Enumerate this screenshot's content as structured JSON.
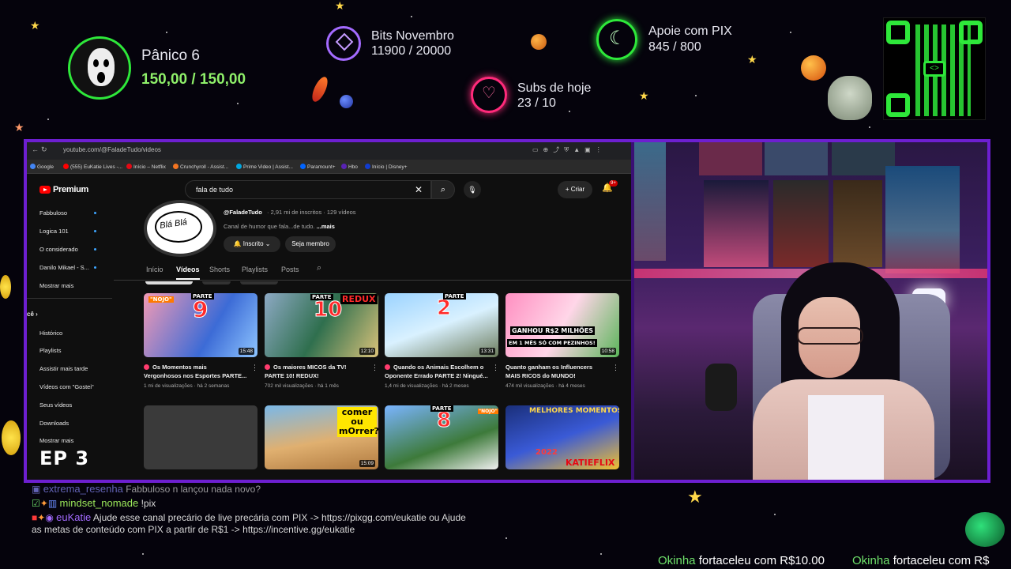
{
  "overlay": {
    "goal_title": "Pânico 6",
    "goal_value": "150,00 / 150,00",
    "bits_title": "Bits Novembro",
    "bits_value": "11900 / 20000",
    "subs_title": "Subs de hoje",
    "subs_value": "23 / 10",
    "pix_title": "Apoie com PIX",
    "pix_value": "845 / 800",
    "episode": "EP 3",
    "colors": {
      "frame": "#6d1fd0",
      "green": "#2ee83a",
      "pink": "#ff2a7a",
      "purple": "#a46bff"
    }
  },
  "browser": {
    "url": "youtube.com/@FaladeTudo/videos",
    "bookmarks": [
      "Google",
      "(555) EuKatie Lives -...",
      "Início – Netflix",
      "Crunchyroll - Assist...",
      "Prime Video | Assist...",
      "Paramount+",
      "Hbo",
      "Início | Disney+"
    ]
  },
  "youtube": {
    "brand": "Premium",
    "search_query": "fala de tudo",
    "create_label": "Criar",
    "notif_count": "9+",
    "sidebar_subs": [
      "Fabbuloso",
      "Logica 101",
      "O considerado",
      "Danilo Mikael - S...",
      "Mostrar mais"
    ],
    "sidebar_you_header": "cê",
    "sidebar_you": [
      "Histórico",
      "Playlists",
      "Assistir mais tarde",
      "Vídeos com \"Gostei\"",
      "Seus vídeos",
      "Downloads",
      "Mostrar mais"
    ],
    "channel": {
      "avatar_text": "Blá Blá",
      "handle": "@FaladeTudo",
      "meta": "· 2,91 mi de inscritos · 129 vídeos",
      "desc": "Canal de humor que fala...de tudo.",
      "desc_more": "...mais",
      "subscribed_label": "Inscrito",
      "member_label": "Seja membro"
    },
    "tabs": [
      "Início",
      "Vídeos",
      "Shorts",
      "Playlists",
      "Posts"
    ],
    "videos": [
      {
        "title1": "Os Momentos mais",
        "title2": "Vergonhosos nos Esportes PARTE...",
        "meta": "1 mi de visualizações · há 2 semanas",
        "duration": "15:48",
        "thumb_text": "9",
        "thumb_tag": "PARTE",
        "thumb_note": "\"NOJO\""
      },
      {
        "title1": "Os maiores MICOS da TV!",
        "title2": "PARTE 10! REDUX!",
        "meta": "702 mil visualizações · há 1 mês",
        "duration": "12:10",
        "thumb_text": "10",
        "thumb_tag": "PARTE",
        "thumb_note": "REDUX"
      },
      {
        "title1": "Quando os Animais Escolhem o",
        "title2": "Oponente Errado PARTE 2! Ningué...",
        "meta": "1,4 mi de visualizações · há 2 meses",
        "duration": "13:31",
        "thumb_text": "2",
        "thumb_tag": "PARTE",
        "thumb_note": ""
      },
      {
        "title1": "Quanto ganham os Influencers",
        "title2": "MAIS RICOS do MUNDO!",
        "meta": "474 mil visualizações · há 4 meses",
        "duration": "10:58",
        "thumb_text": "GANHOU R$2 MILHÕES",
        "thumb_tag": "EM 1 MÊS SÓ COM PEZINHOS!",
        "thumb_note": ""
      },
      {
        "title1": "",
        "title2": "",
        "meta": "",
        "duration": "",
        "thumb_text": "",
        "thumb_tag": "",
        "thumb_note": ""
      },
      {
        "title1": "",
        "title2": "",
        "meta": "",
        "duration": "15:09",
        "thumb_text": "comer ou mOrrer?",
        "thumb_tag": "",
        "thumb_note": ""
      },
      {
        "title1": "",
        "title2": "",
        "meta": "",
        "duration": "",
        "thumb_text": "8",
        "thumb_tag": "PARTE",
        "thumb_note": "\"NOJO\""
      },
      {
        "title1": "",
        "title2": "",
        "meta": "",
        "duration": "",
        "thumb_text": "MELHORES MOMENTOS",
        "thumb_tag": "2022",
        "thumb_note": "KATIEFLIX"
      }
    ]
  },
  "chat": [
    {
      "name": "extrema_resenha",
      "msg": "Fabbuloso n lançou nada novo?",
      "color": "#8a8cff"
    },
    {
      "name": "mindset_nomade",
      "msg": "!pix",
      "color": "#9be85a"
    },
    {
      "name": "euKatie",
      "msg": "Ajude esse canal precário de live precária com PIX -> https://pixgg.com/eukatie ou Ajude",
      "msg2": "as metas de conteúdo com PIX a partir de R$1 -> https://incentive.gg/eukatie",
      "color": "#a36bff"
    }
  ],
  "ticker": [
    {
      "name": "Okinha",
      "msg": "fortaceleu com R$10.00"
    },
    {
      "name": "Okinha",
      "msg": "fortaceleu com R$"
    }
  ]
}
